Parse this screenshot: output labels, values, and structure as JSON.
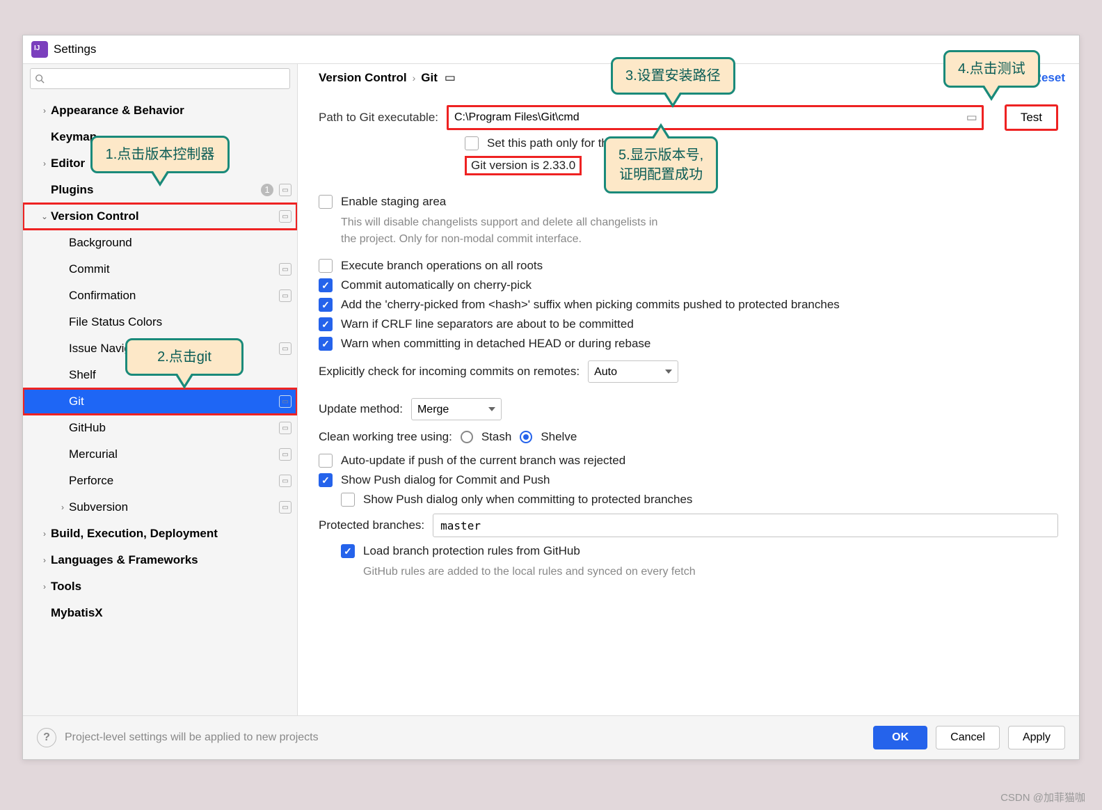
{
  "window": {
    "title": "Settings"
  },
  "search": {
    "placeholder": ""
  },
  "sidebar": {
    "items": [
      {
        "label": "Appearance & Behavior",
        "level": 0,
        "bold": true,
        "exp": "›"
      },
      {
        "label": "Keymap",
        "level": 0,
        "bold": true
      },
      {
        "label": "Editor",
        "level": 0,
        "bold": true,
        "exp": "›"
      },
      {
        "label": "Plugins",
        "level": 0,
        "bold": true,
        "badge": "1",
        "proj": true
      },
      {
        "label": "Version Control",
        "level": 0,
        "bold": true,
        "exp": "⌄",
        "proj": true,
        "outline": true
      },
      {
        "label": "Background",
        "level": 1
      },
      {
        "label": "Commit",
        "level": 1,
        "proj": true
      },
      {
        "label": "Confirmation",
        "level": 1,
        "proj": true
      },
      {
        "label": "File Status Colors",
        "level": 1
      },
      {
        "label": "Issue Navigation",
        "level": 1,
        "proj": true
      },
      {
        "label": "Shelf",
        "level": 1
      },
      {
        "label": "Git",
        "level": 1,
        "proj": true,
        "selected": true,
        "outline": true
      },
      {
        "label": "GitHub",
        "level": 1,
        "proj": true
      },
      {
        "label": "Mercurial",
        "level": 1,
        "proj": true
      },
      {
        "label": "Perforce",
        "level": 1,
        "proj": true
      },
      {
        "label": "Subversion",
        "level": 1,
        "exp": "›",
        "proj": true
      },
      {
        "label": "Build, Execution, Deployment",
        "level": 0,
        "bold": true,
        "exp": "›"
      },
      {
        "label": "Languages & Frameworks",
        "level": 0,
        "bold": true,
        "exp": "›"
      },
      {
        "label": "Tools",
        "level": 0,
        "bold": true,
        "exp": "›"
      },
      {
        "label": "MybatisX",
        "level": 0,
        "bold": true
      }
    ]
  },
  "breadcrumb": {
    "root": "Version Control",
    "leaf": "Git"
  },
  "reset": "Reset",
  "git": {
    "path_label": "Path to Git executable:",
    "path_value": "C:\\Program Files\\Git\\cmd",
    "test": "Test",
    "set_this_path": "Set this path only for this project",
    "version": "Git version is 2.33.0",
    "enable_staging": "Enable staging area",
    "enable_staging_hint1": "This will disable changelists support and delete all changelists in",
    "enable_staging_hint2": "the project. Only for non-modal commit interface.",
    "exec_all_roots": "Execute branch operations on all roots",
    "auto_cherry": "Commit automatically on cherry-pick",
    "add_suffix": "Add the 'cherry-picked from <hash>' suffix when picking commits pushed to protected branches",
    "warn_crlf": "Warn if CRLF line separators are about to be committed",
    "warn_detached": "Warn when committing in detached HEAD or during rebase",
    "check_remotes_label": "Explicitly check for incoming commits on remotes:",
    "check_remotes_value": "Auto",
    "update_method_label": "Update method:",
    "update_method_value": "Merge",
    "clean_tree_label": "Clean working tree using:",
    "stash": "Stash",
    "shelve": "Shelve",
    "auto_update": "Auto-update if push of the current branch was rejected",
    "show_push": "Show Push dialog for Commit and Push",
    "show_push_protected": "Show Push dialog only when committing to protected branches",
    "protected_label": "Protected branches:",
    "protected_value": "master",
    "load_github": "Load branch protection rules from GitHub",
    "load_github_hint": "GitHub rules are added to the local rules and synced on every fetch"
  },
  "footer": {
    "help_text": "Project-level settings will be applied to new projects",
    "ok": "OK",
    "cancel": "Cancel",
    "apply": "Apply"
  },
  "callouts": {
    "c1": "1.点击版本控制器",
    "c2": "2.点击git",
    "c3": "3.设置安装路径",
    "c4": "4.点击测试",
    "c5a": "5.显示版本号,",
    "c5b": "证明配置成功"
  },
  "watermark": "CSDN @加菲猫咖"
}
